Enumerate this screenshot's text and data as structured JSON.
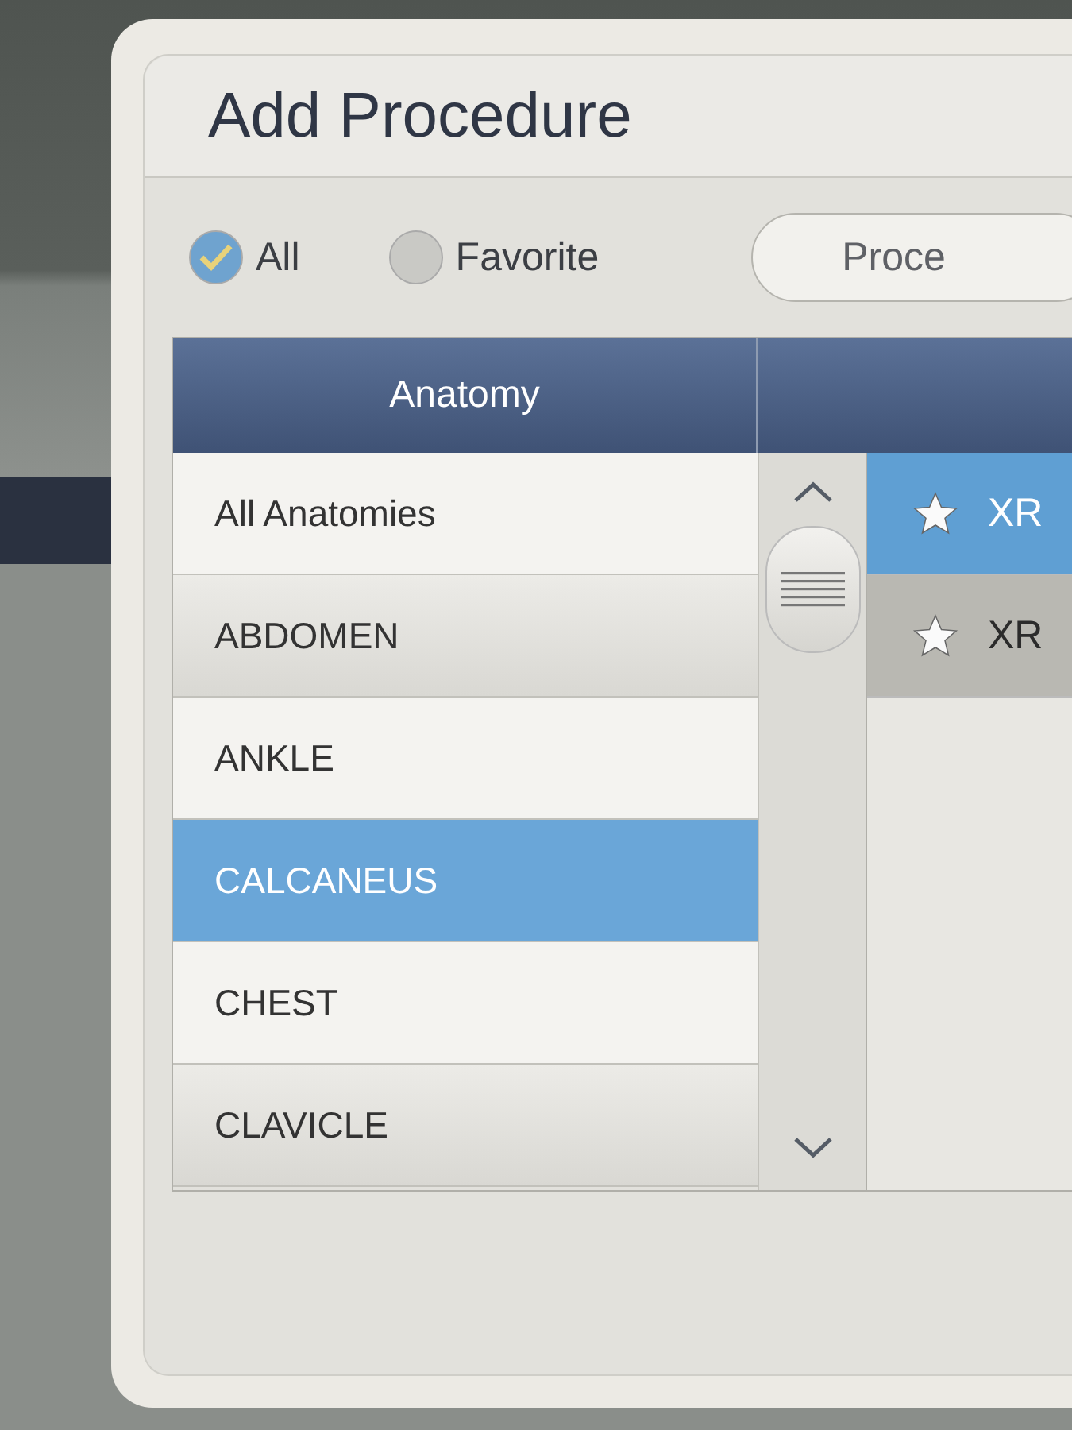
{
  "dialog": {
    "title": "Add Procedure"
  },
  "filters": [
    {
      "label": "All",
      "selected": true
    },
    {
      "label": "Favorite",
      "selected": false
    }
  ],
  "search": {
    "placeholder": "Proce"
  },
  "anatomy": {
    "header": "Anatomy",
    "items": [
      {
        "label": "All Anatomies",
        "selected": false
      },
      {
        "label": "ABDOMEN",
        "selected": false
      },
      {
        "label": "ANKLE",
        "selected": false
      },
      {
        "label": "CALCANEUS",
        "selected": true
      },
      {
        "label": "CHEST",
        "selected": false
      },
      {
        "label": "CLAVICLE",
        "selected": false
      }
    ]
  },
  "procedures": [
    {
      "label": "XR",
      "selected": true
    },
    {
      "label": "XR",
      "selected": false
    }
  ]
}
